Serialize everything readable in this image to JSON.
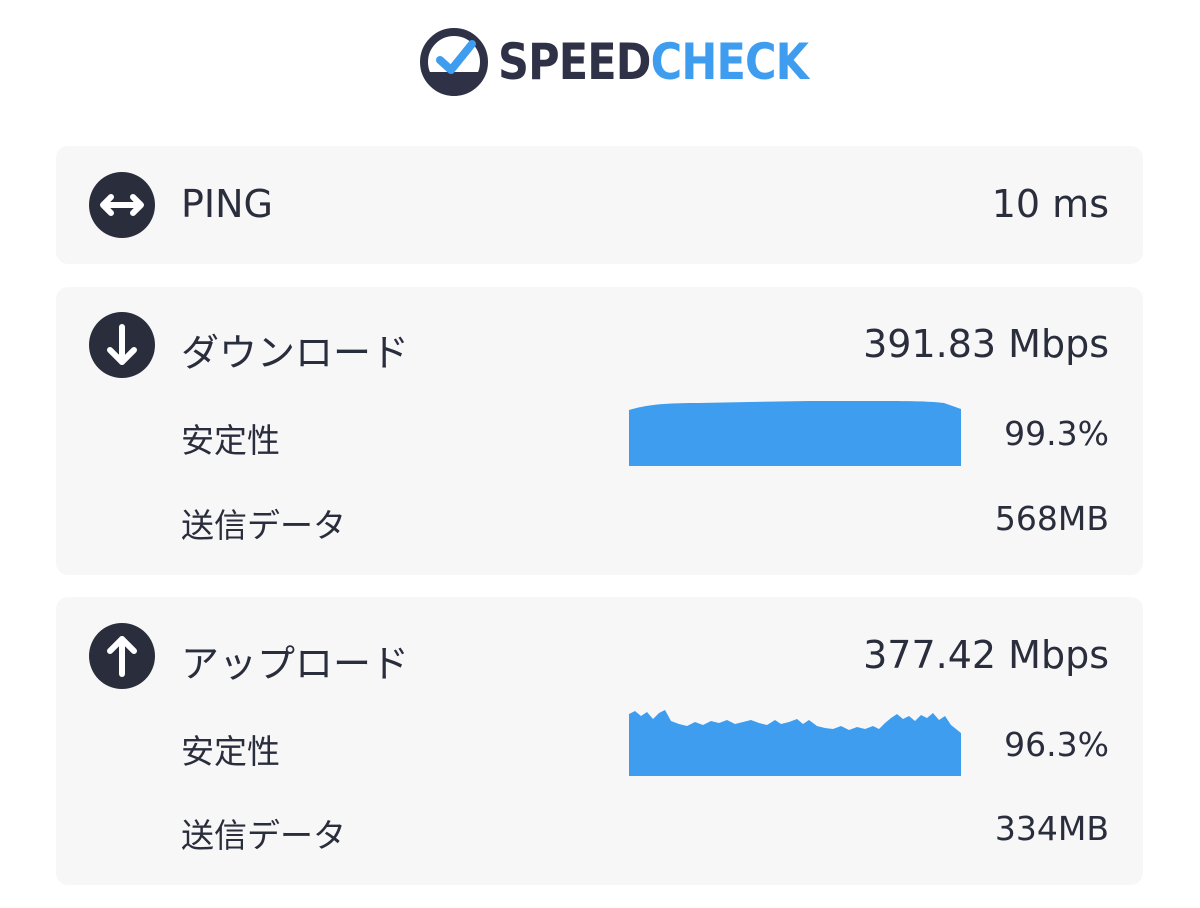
{
  "brand": {
    "name_part1": "SPEED",
    "name_part2": "CHECK"
  },
  "ping": {
    "label": "PING",
    "value": "10 ms",
    "icon": "horizontal-arrows-icon"
  },
  "download": {
    "label": "ダウンロード",
    "value": "391.83 Mbps",
    "icon": "arrow-down-icon",
    "stability_label": "安定性",
    "stability_value": "99.3%",
    "data_label": "送信データ",
    "data_value": "568MB"
  },
  "upload": {
    "label": "アップロード",
    "value": "377.42 Mbps",
    "icon": "arrow-up-icon",
    "stability_label": "安定性",
    "stability_value": "96.3%",
    "data_label": "送信データ",
    "data_value": "334MB"
  },
  "colors": {
    "brand_dark": "#2f3247",
    "brand_blue": "#3f9df0",
    "graph_fill": "#3f9df0",
    "card_bg": "#f7f7f8",
    "text": "#2a2d3c"
  }
}
